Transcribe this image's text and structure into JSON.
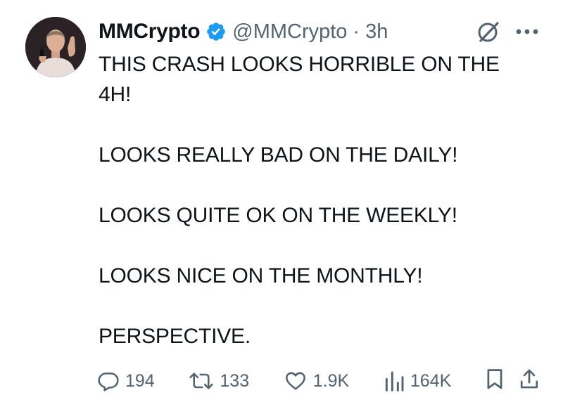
{
  "author": {
    "name": "MMCrypto",
    "handle": "@MMCrypto",
    "separator": "·",
    "time": "3h"
  },
  "tweet": {
    "lines": [
      "THIS CRASH LOOKS HORRIBLE ON THE",
      "4H!",
      "LOOKS REALLY BAD ON THE DAILY!",
      "LOOKS QUITE OK ON THE WEEKLY!",
      "LOOKS NICE ON THE MONTHLY!",
      "PERSPECTIVE."
    ]
  },
  "actions": {
    "replies": "194",
    "reposts": "133",
    "likes": "1.9K",
    "views": "164K"
  },
  "icons": {
    "verified": "verified-badge-icon",
    "grok": "grok-icon",
    "more": "more-icon",
    "reply": "reply-icon",
    "repost": "repost-icon",
    "like": "heart-icon",
    "views": "views-icon",
    "bookmark": "bookmark-icon",
    "share": "share-icon"
  },
  "colors": {
    "verified": "#1d9bf0",
    "text": "#0f1419",
    "muted": "#536471"
  }
}
